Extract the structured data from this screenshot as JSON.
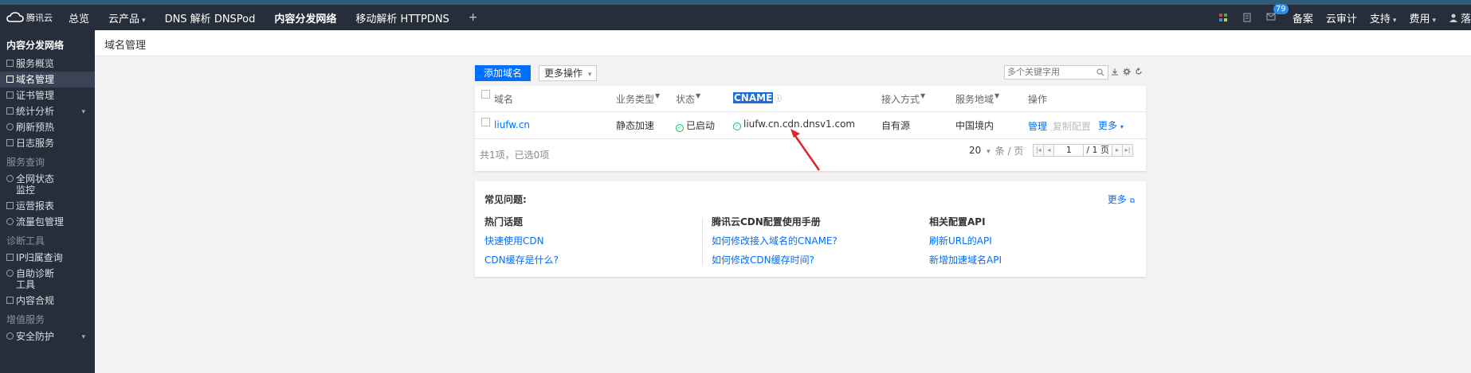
{
  "topbar": {
    "brand": "腾讯云",
    "nav": [
      {
        "label": "总览"
      },
      {
        "label": "云产品",
        "caret": "▾"
      },
      {
        "label": "DNS 解析 DNSPod"
      },
      {
        "label": "内容分发网络"
      },
      {
        "label": "移动解析 HTTPDNS"
      }
    ],
    "add_label": "+",
    "badge_count": "79",
    "right_links": [
      {
        "label": "备案"
      },
      {
        "label": "云审计"
      },
      {
        "label": "支持",
        "caret": "▾"
      },
      {
        "label": "费用",
        "caret": "▾"
      },
      {
        "label": "落"
      }
    ]
  },
  "sidebar": {
    "title": "内容分发网络",
    "items1": [
      {
        "label": "服务概览"
      },
      {
        "label": "域名管理",
        "active": true
      },
      {
        "label": "证书管理"
      },
      {
        "label": "统计分析",
        "caret": "▾"
      },
      {
        "label": "刷新预热"
      },
      {
        "label": "日志服务"
      }
    ],
    "group1": "服务查询",
    "items2": [
      {
        "label": "全网状态监控"
      },
      {
        "label": "运营报表"
      },
      {
        "label": "流量包管理"
      }
    ],
    "group2": "诊断工具",
    "items3": [
      {
        "label": "IP归属查询"
      },
      {
        "label": "自助诊断工具"
      },
      {
        "label": "内容合规"
      }
    ],
    "group3": "增值服务",
    "items4": [
      {
        "label": "安全防护",
        "caret": "▾"
      }
    ]
  },
  "header": {
    "title": "域名管理"
  },
  "toolbar": {
    "add_button": "添加域名",
    "more_button": "更多操作",
    "more_caret": "▾",
    "search_placeholder": "多个关键字用"
  },
  "table": {
    "columns": {
      "domain": "域名",
      "service_type": "业务类型",
      "status": "状态",
      "cname": "CNAME",
      "access": "接入方式",
      "region": "服务地域",
      "actions": "操作"
    },
    "rows": [
      {
        "domain": "liufw.cn",
        "service_type": "静态加速",
        "status": "已启动",
        "cname": "liufw.cn.cdn.dnsv1.com",
        "access": "自有源",
        "region": "中国境内",
        "action_manage": "管理",
        "action_copy": "复制配置",
        "action_more": "更多"
      }
    ],
    "footer_summary": "共1项，已选0项",
    "page_size": "20",
    "page_size_caret": "▾",
    "page_unit": "条 / 页",
    "current_page": "1",
    "total_pages": "/ 1 页"
  },
  "faq": {
    "title": "常见问题:",
    "more": "更多",
    "col1_title": "热门话题",
    "col1_links": [
      "快速使用CDN",
      "CDN缓存是什么?"
    ],
    "col2_title": "腾讯云CDN配置使用手册",
    "col2_links": [
      "如何修改接入域名的CNAME?",
      "如何修改CDN缓存时间?"
    ],
    "col3_title": "相关配置API",
    "col3_links": [
      "刷新URL的API",
      "新增加速域名API"
    ]
  },
  "colors": {
    "topbar_bg": "#262e3b",
    "accent": "#006eff",
    "status_ok": "#0abf5b",
    "arrow": "#e0242c"
  }
}
